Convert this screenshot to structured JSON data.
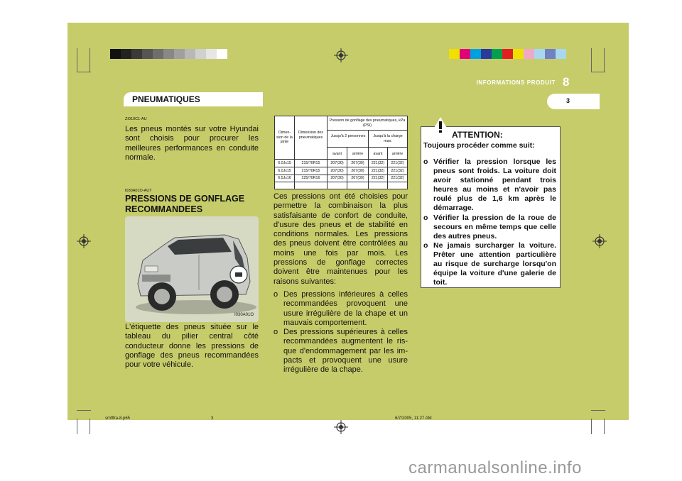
{
  "header": {
    "section": "INFORMATIONS PRODUIT",
    "chapter": "8",
    "page": "3"
  },
  "section_title": "PNEUMATIQUES",
  "left": {
    "code1": "ZI010C1-AU",
    "intro": "Les pneus montés sur votre Hyundai sont choisis pour procurer les meilleures performances en conduite normale.",
    "code2": "I030A01O-AUT",
    "heading": "PRESSIONS DE GONFLAGE RECOMMANDEES",
    "photo_caption": "I030A01O",
    "label_text": "L'étiquette des pneus située sur le tableau du pilier central côté conducteur donne les pressions de gonflage des pneus recommandées pour votre véhicule."
  },
  "table": {
    "col_rim": "Dimen- sion de la jante",
    "col_tire": "Dimension des pneumatiques",
    "col_pressure": "Pression de gonflage des pneumatiques, kPa (PSI)",
    "col_2p": "Jusqu'à 2 personnes",
    "col_max": "Jusqu'à la charge max.",
    "front": "avant",
    "rear": "arrière",
    "rows": [
      {
        "rim": "6.0Jx15",
        "tire": "215/70R15",
        "a1": "207(30)",
        "r1": "207(30)",
        "a2": "221(32)",
        "r2": "221(32)"
      },
      {
        "rim": "6.0Jx15",
        "tire": "215/70R15",
        "a1": "207(30)",
        "r1": "207(30)",
        "a2": "221(32)",
        "r2": "221(32)"
      },
      {
        "rim": "6.5Jx16",
        "tire": "225/70R16",
        "a1": "207(30)",
        "r1": "207(30)",
        "a2": "221(32)",
        "r2": "221(32)"
      }
    ]
  },
  "middle": {
    "para": "Ces pressions ont été choisies pour permettre la combinaison la plus satisfaisante de confort de conduite, d'usure des pneus et de stabilité en conditions normales. Les pressions des pneus doivent être contrôlées au moins une fois par mois. Les pressions de gonflage correctes doivent être maintenues pour les raisons suivantes:",
    "bullet": "o",
    "items": [
      "Des pressions inférieures à celles recommandées provoquent une usure irrégulière de la chape et un mauvais comportement.",
      "Des pressions supérieures à celles recommandées augmentent le ris- que d'endommagement par les im- pacts et provoquent une usure irrégulière de la chape."
    ]
  },
  "warning": {
    "title": "ATTENTION:",
    "lead": "Toujours procéder comme suit:",
    "bullet": "o",
    "items": [
      "Vérifier la pression lorsque les pneus sont froids. La voiture doit avoir stationné pendant trois heures au moins et n'avoir pas roulé plus de 1,6 km après le démarrage.",
      "Vérifier la pression de la roue de secours en même temps que celle des autres pneus.",
      "Ne jamais surcharger la voiture. Prêter une attention particulière au risque de surcharge lorsqu'on équipe la voiture d'une galerie de toit."
    ]
  },
  "footer": {
    "file": "smflfra-8.p65",
    "page": "3",
    "date": "6/7/2005, 11:27 AM"
  },
  "watermark": "carmanualsonline.info",
  "colors": {
    "page_bg": "#c6cc6a",
    "grayscale_bar": [
      "#111111",
      "#222222",
      "#3a3a3a",
      "#555555",
      "#6e6e6e",
      "#888888",
      "#a0a0a0",
      "#b8b8b8",
      "#d0d0d0",
      "#e6e6e6",
      "#ffffff"
    ],
    "color_bar": [
      "#f0e000",
      "#e0007a",
      "#00a0e0",
      "#2a3a9a",
      "#00a050",
      "#e02020",
      "#f0e000",
      "#f0a8c8",
      "#a8d8f0",
      "#7080c0",
      "#a8d8f0"
    ]
  }
}
